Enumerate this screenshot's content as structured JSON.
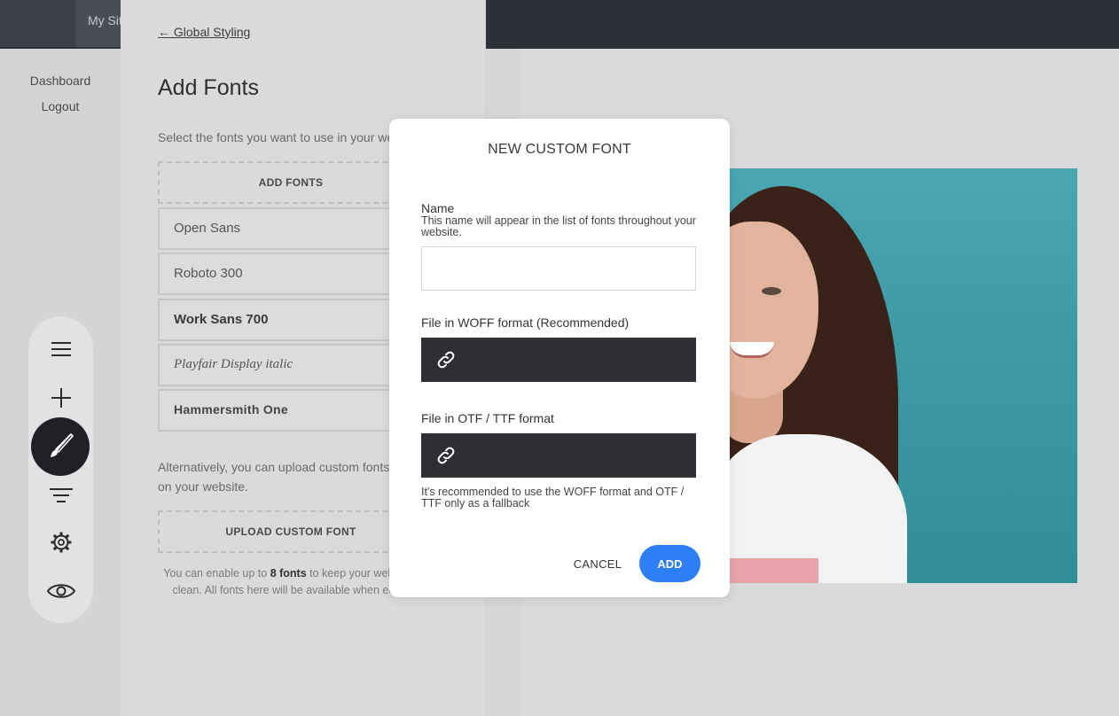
{
  "topbar": {
    "site_tab": "My Site"
  },
  "leftnav": {
    "items": [
      {
        "label": "Dashboard"
      },
      {
        "label": "Logout"
      }
    ]
  },
  "toolbar": {
    "icons": [
      "menu-icon",
      "plus-icon",
      "brush-icon",
      "filter-icon",
      "gear-icon",
      "eye-icon"
    ],
    "active": "brush-icon"
  },
  "panel": {
    "back_link": "← Global Styling",
    "title": "Add Fonts",
    "description": "Select the fonts you want to use in your website.",
    "add_fonts_button": "ADD FONTS",
    "fonts": [
      {
        "name": "Open Sans"
      },
      {
        "name": "Roboto 300"
      },
      {
        "name": "Work Sans 700"
      },
      {
        "name": "Playfair Display italic"
      },
      {
        "name": "Hammersmith One"
      }
    ],
    "alternative_line1": "Alternatively, you can upload custom fonts to use",
    "alternative_line2": "on your website.",
    "upload_button": "UPLOAD CUSTOM FONT",
    "note_prefix": "You can enable up to ",
    "note_bold": "8 fonts",
    "note_suffix": " to keep your website fast and clean. All fonts here will be available when editing texts."
  },
  "modal": {
    "title": "NEW CUSTOM FONT",
    "name_label": "Name",
    "name_help": "This name will appear in the list of fonts throughout your website.",
    "name_value": "",
    "woff_label": "File in WOFF format (Recommended)",
    "otf_label": "File in OTF / TTF format",
    "footer_help": "It's recommended to use the WOFF format and OTF / TTF only as a fallback",
    "cancel_label": "CANCEL",
    "add_label": "ADD",
    "colors": {
      "add_button": "#2c7ff7",
      "file_field": "#2d2f35"
    }
  }
}
